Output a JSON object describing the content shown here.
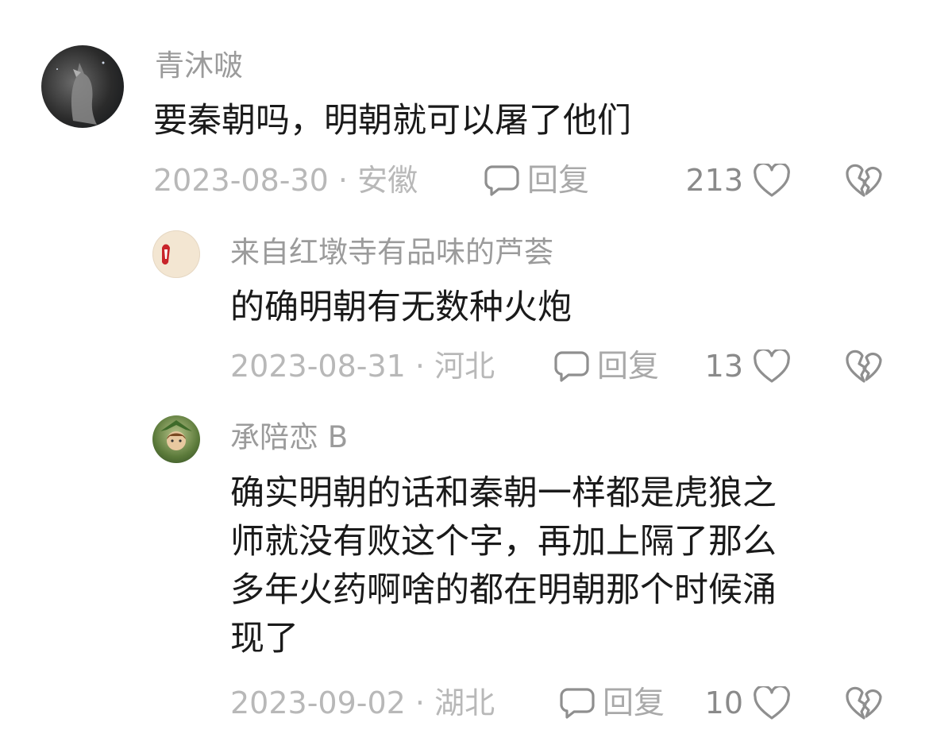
{
  "comments": [
    {
      "username": "青沐啵",
      "avatar_icon": "wolf-avatar-icon",
      "text_lines": [
        "要秦朝吗，明朝就可以屠了他们"
      ],
      "date": "2023-08-30",
      "location": "安徽",
      "meta": "2023-08-30 · 安徽",
      "reply_label": "回复",
      "likes": "213"
    },
    {
      "username": "来自红墩寺有品味的芦荟",
      "avatar_icon": "illustrated-avatar-icon",
      "text_lines": [
        "的确明朝有无数种火炮"
      ],
      "date": "2023-08-31",
      "location": "河北",
      "meta": "2023-08-31 · 河北",
      "reply_label": "回复",
      "likes": "13"
    },
    {
      "username": "承陪恋 B",
      "avatar_icon": "green-character-avatar-icon",
      "text_lines": [
        "确实明朝的话和秦朝一样都是虎狼之",
        "师就没有败这个字，再加上隔了那么",
        "多年火药啊啥的都在明朝那个时候涌",
        "现了"
      ],
      "date": "2023-09-02",
      "location": "湖北",
      "meta": "2023-09-02 · 湖北",
      "reply_label": "回复",
      "likes": "10"
    }
  ],
  "colors": {
    "username": "#9b9b9b",
    "body_text": "#1a1a1a",
    "meta_text": "#b8b8b8",
    "icon": "#8f8f8f"
  }
}
